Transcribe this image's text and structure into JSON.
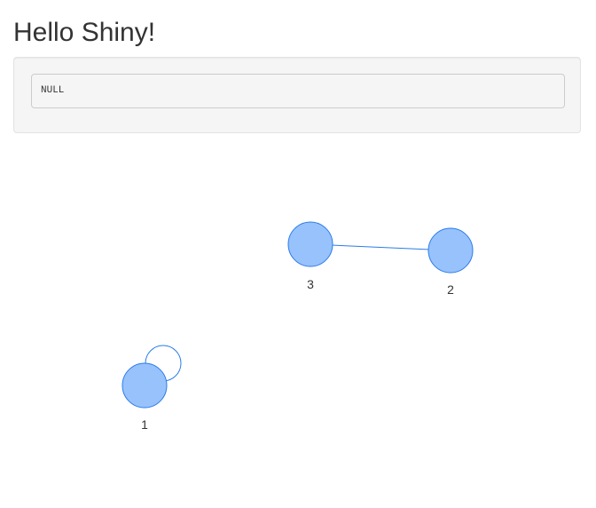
{
  "app": {
    "title": "Hello Shiny!"
  },
  "output": {
    "value": "NULL"
  },
  "network": {
    "colors": {
      "node_fill": "#97c2fc",
      "node_border": "#2b7ce9",
      "edge": "#2b7ce9"
    },
    "nodes": [
      {
        "id": "1",
        "label": "1"
      },
      {
        "id": "2",
        "label": "2"
      },
      {
        "id": "3",
        "label": "3"
      }
    ],
    "edges": [
      {
        "from": "3",
        "to": "2"
      },
      {
        "from": "1",
        "to": "1"
      }
    ]
  }
}
